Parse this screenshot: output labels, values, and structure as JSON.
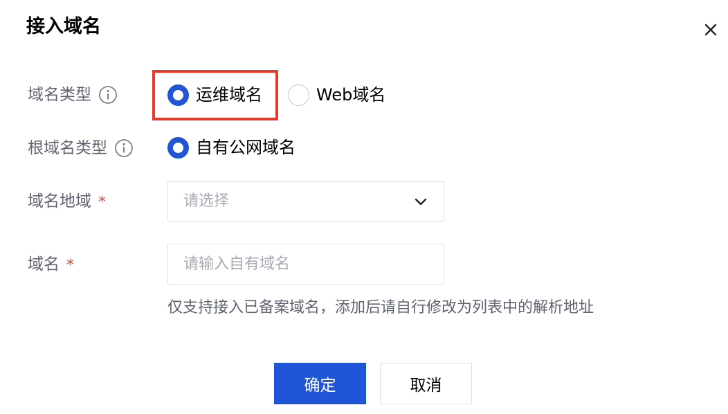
{
  "dialog": {
    "title": "接入域名",
    "close_icon": "close-icon"
  },
  "form": {
    "domain_type": {
      "label": "域名类型",
      "icon": "info-icon",
      "options": [
        {
          "label": "运维域名",
          "selected": true,
          "highlighted": true
        },
        {
          "label": "Web域名",
          "selected": false
        }
      ]
    },
    "root_domain_type": {
      "label": "根域名类型",
      "icon": "info-icon",
      "options": [
        {
          "label": "自有公网域名",
          "selected": true
        }
      ]
    },
    "region": {
      "label": "域名地域",
      "required_mark": "*",
      "placeholder": "请选择",
      "icon": "chevron-down-icon"
    },
    "domain": {
      "label": "域名",
      "required_mark": "*",
      "placeholder": "请输入自有域名",
      "value": "",
      "hint": "仅支持接入已备案域名，添加后请自行修改为列表中的解析地址"
    }
  },
  "footer": {
    "confirm_label": "确定",
    "cancel_label": "取消"
  },
  "colors": {
    "primary": "#1f55d6",
    "highlight_border": "#e53b2c",
    "required": "#e54545",
    "label_text": "#5f6470",
    "placeholder": "#a6aab3"
  }
}
